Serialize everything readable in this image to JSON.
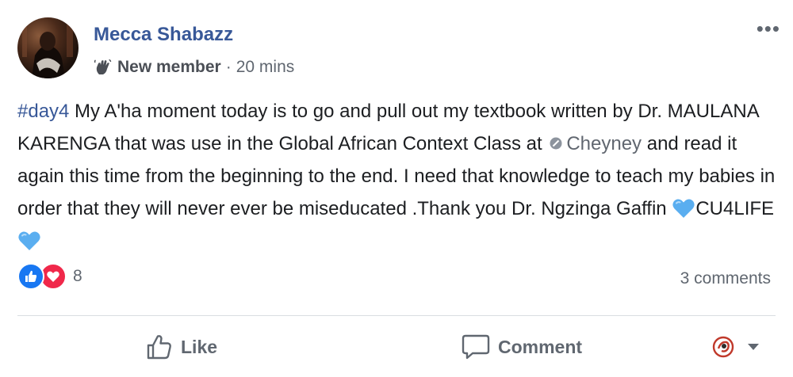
{
  "post": {
    "author": "Mecca Shabazz",
    "badge": "New member",
    "separator": "·",
    "time": "20 mins",
    "more": "•••",
    "hashtag": "#day4",
    "text_part1": " My A'ha moment today is to go and pull out my textbook written by Dr. MAULANA KARENGA that was use in the Global African Context Class at ",
    "mention": "Cheyney",
    "text_part2": " and read it again this time from the beginning to the end. I need that knowledge to teach my babies in order that they will never ever be miseducated .Thank you Dr. Ngzinga Gaffin ",
    "text_part3": "CU4LIFE",
    "reaction_count": "8",
    "comments": "3 comments"
  },
  "actions": {
    "like": "Like",
    "comment": "Comment"
  },
  "colors": {
    "author": "#385898",
    "like_blue": "#1877f2",
    "love_red": "#f0284a",
    "heart": "#5aaef0"
  },
  "icons": {
    "reactions": [
      "like-icon",
      "love-icon"
    ],
    "badge": "waving-hand-icon",
    "mention": "verified-place-icon",
    "emoji": "blue-heart-emoji"
  }
}
